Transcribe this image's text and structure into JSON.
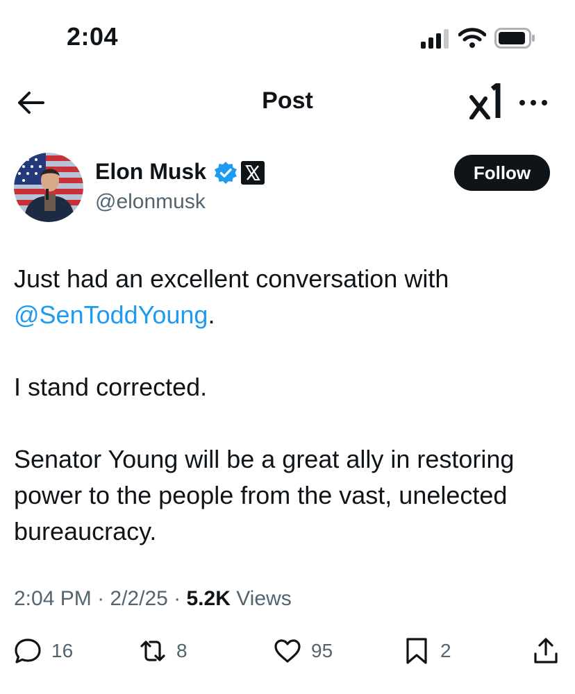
{
  "status_bar": {
    "time": "2:04",
    "icons": [
      "signal-icon",
      "wifi-icon",
      "battery-icon"
    ]
  },
  "header": {
    "title": "Post",
    "icons": [
      "back-arrow-icon",
      "grok-icon",
      "more-icon"
    ]
  },
  "author": {
    "name": "Elon Musk",
    "handle": "@elonmusk",
    "verified_icon": "verified-badge-icon",
    "affiliation_icon": "x-logo-icon",
    "follow_label": "Follow"
  },
  "post": {
    "line1": "Just had an excellent conversation with",
    "mention": "@SenToddYoung",
    "mention_suffix": ".",
    "paragraph2": "I stand corrected.",
    "paragraph3": "Senator Young will be a great ally in restoring power to the people from the vast, unelected bureaucracy."
  },
  "meta": {
    "time": "2:04 PM",
    "sep1": " · ",
    "date": "2/2/25",
    "sep2": " · ",
    "views_count": "5.2K",
    "views_label": " Views"
  },
  "actions": {
    "replies": "16",
    "reposts": "8",
    "likes": "95",
    "bookmarks": "2"
  },
  "colors": {
    "accent": "#1d9bf0",
    "text": "#0f1419",
    "secondary": "#536471"
  }
}
